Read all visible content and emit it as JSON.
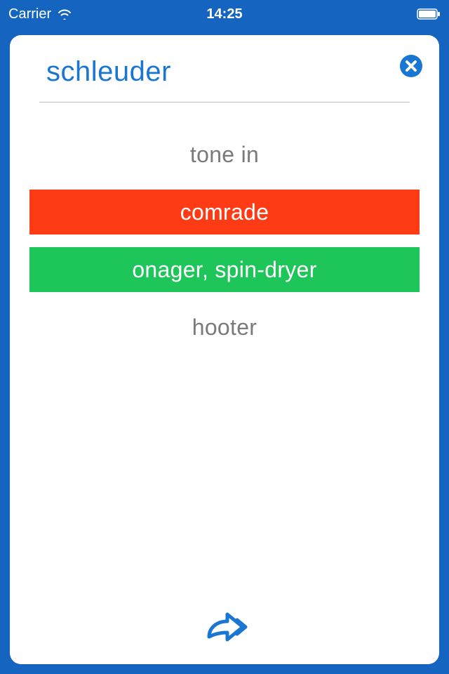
{
  "status": {
    "carrier": "Carrier",
    "time": "14:25"
  },
  "card": {
    "word": "schleuder",
    "options": [
      {
        "label": "tone in",
        "state": "plain"
      },
      {
        "label": "comrade",
        "state": "red"
      },
      {
        "label": "onager, spin-dryer",
        "state": "green"
      },
      {
        "label": "hooter",
        "state": "plain"
      }
    ]
  },
  "colors": {
    "background": "#1565c0",
    "accent": "#1976d2",
    "red": "#ff3b15",
    "green": "#1ec659",
    "grayText": "#7a7a7a"
  }
}
